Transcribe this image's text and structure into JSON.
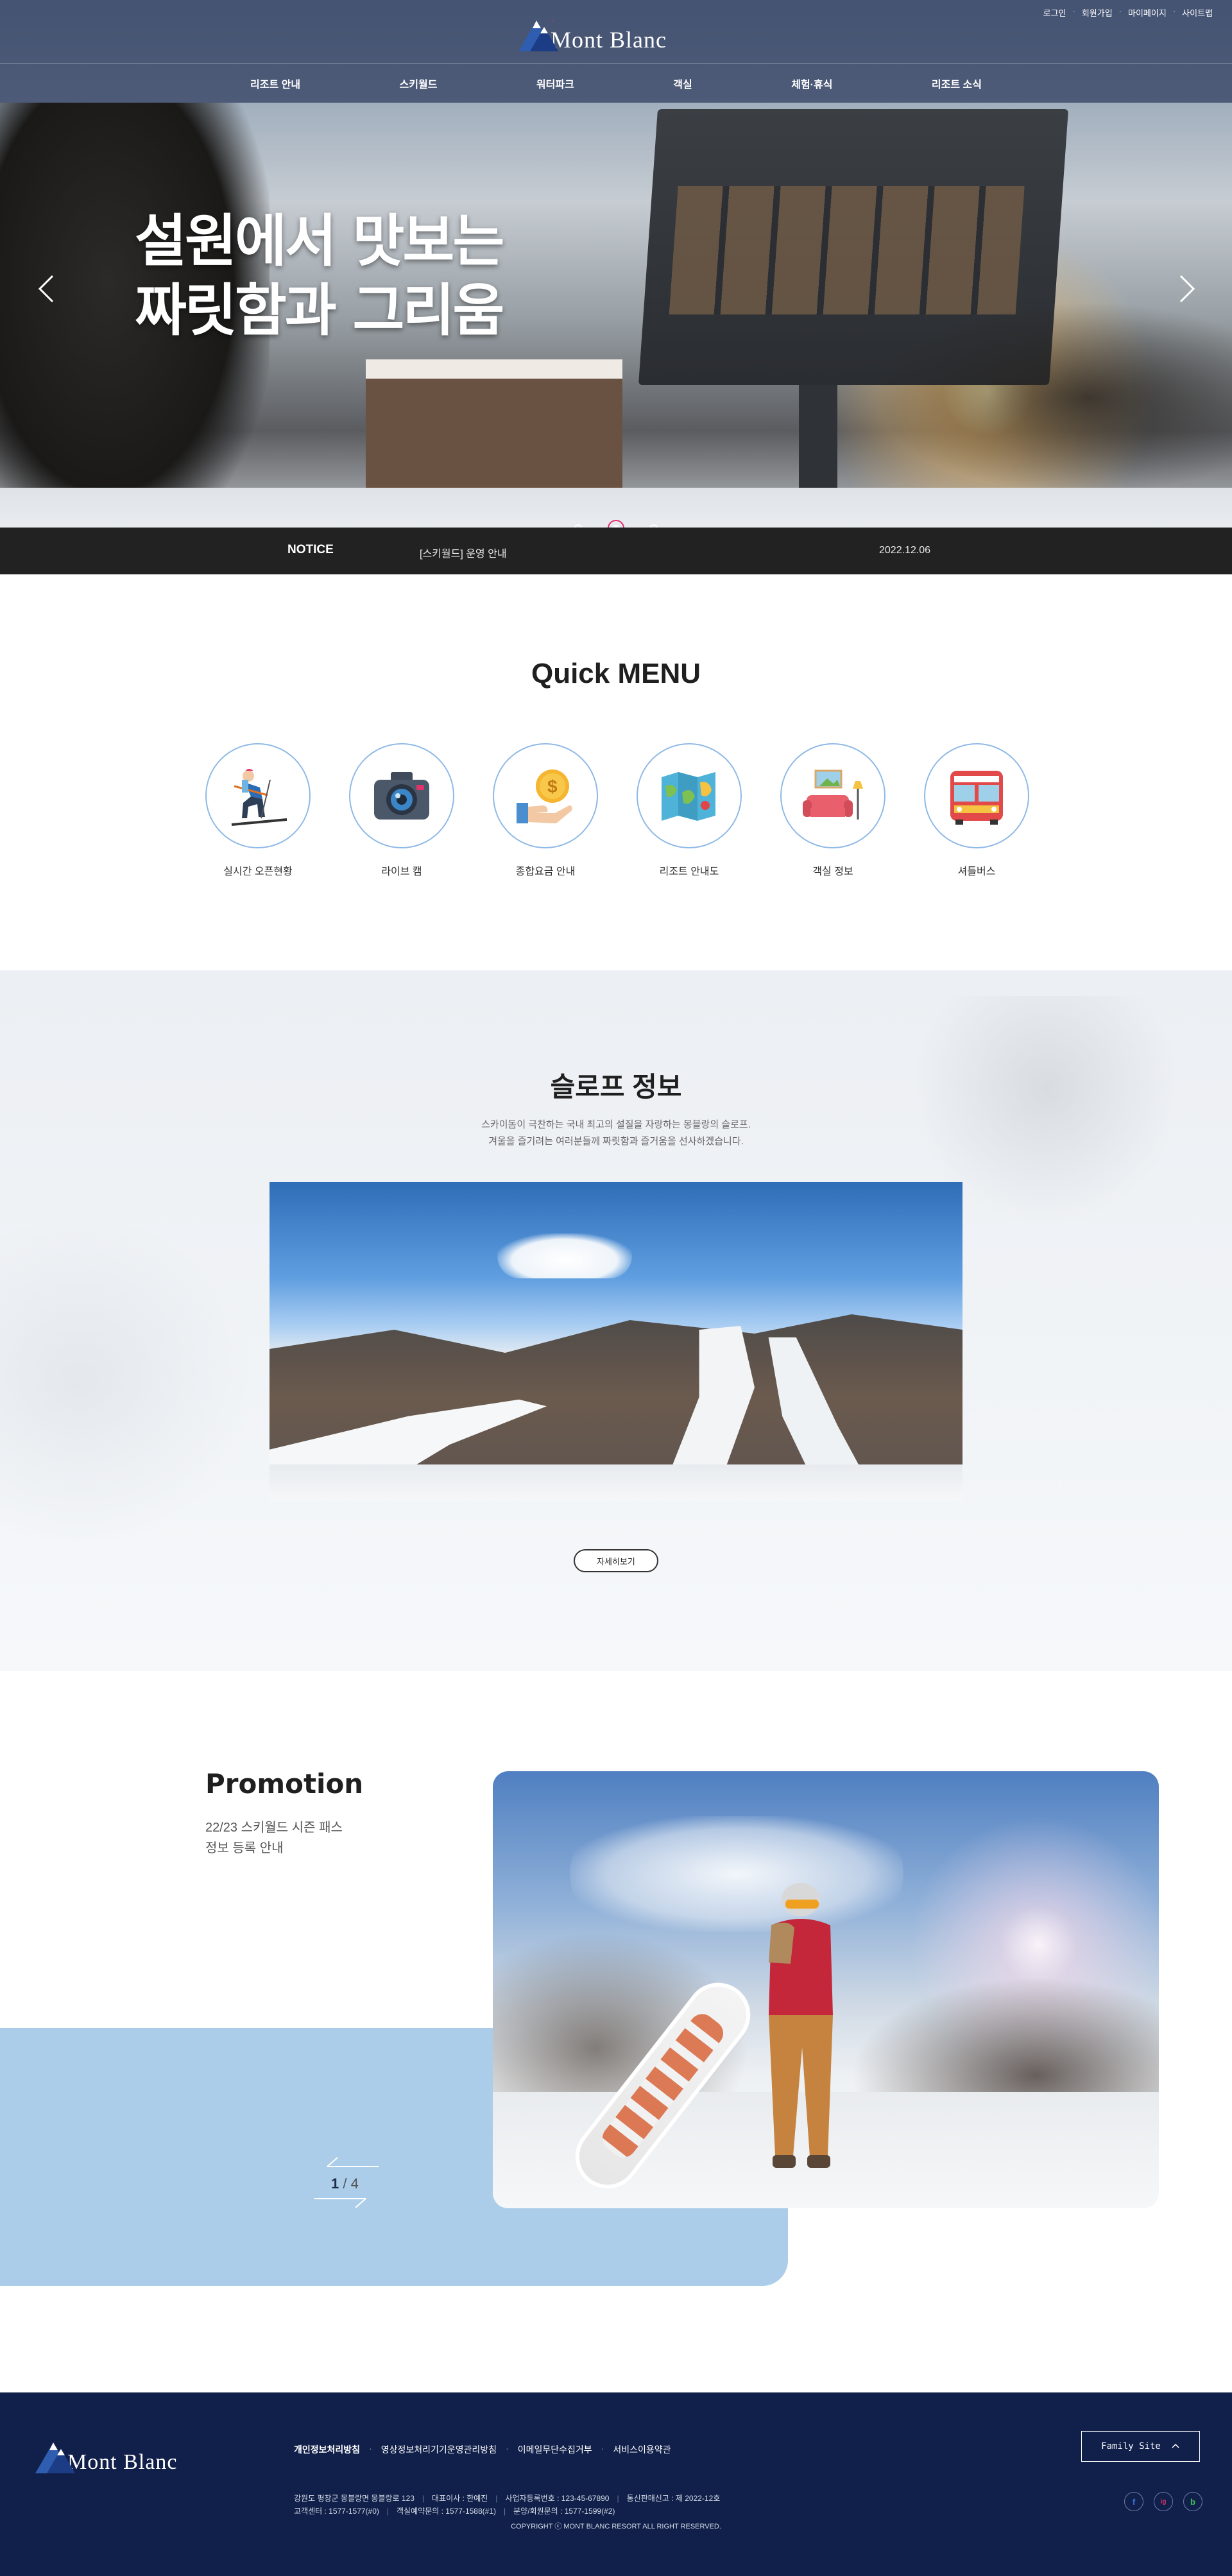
{
  "header": {
    "util_links": [
      "로그인",
      "회원가입",
      "마이페이지",
      "사이트맵"
    ],
    "logo_text": "Mont Blanc",
    "nav": [
      "리조트 안내",
      "스키월드",
      "워터파크",
      "객실",
      "체험·휴식",
      "리조트 소식"
    ]
  },
  "hero": {
    "title_line1": "설원에서 맛보는",
    "title_line2": "짜릿함과 그리움",
    "slide_count": 3,
    "active_slide": 2
  },
  "notice": {
    "label": "NOTICE",
    "text": "[스키월드] 운영 안내",
    "date": "2022.12.06"
  },
  "quick_menu": {
    "title": "Quick MENU",
    "items": [
      {
        "label": "실시간 오픈현황",
        "icon": "skier-icon"
      },
      {
        "label": "라이브 캠",
        "icon": "camera-icon"
      },
      {
        "label": "종합요금 안내",
        "icon": "coin-hand-icon"
      },
      {
        "label": "리조트 안내도",
        "icon": "map-icon"
      },
      {
        "label": "객실 정보",
        "icon": "sofa-icon"
      },
      {
        "label": "셔틀버스",
        "icon": "bus-icon"
      }
    ]
  },
  "slope": {
    "title": "슬로프 정보",
    "desc_line1": "스카이돔이 극찬하는 국내 최고의 설질을 자랑하는 몽블랑의 슬로프.",
    "desc_line2": "겨울을 즐기려는 여러분들께 짜릿함과 즐거움을 선사하겠습니다.",
    "button": "자세히보기"
  },
  "promotion": {
    "title": "Promotion",
    "desc_line1": "22/23 스키월드 시즌 패스",
    "desc_line2": "정보 등록 안내",
    "page_current": "1",
    "page_total": "/ 4"
  },
  "footer": {
    "logo_text": "Mont Blanc",
    "links": [
      "개인정보처리방침",
      "영상정보처리기기운영관리방침",
      "이메일무단수집거부",
      "서비스이용약관"
    ],
    "info_row1": [
      "강원도 평창군 몽블랑면 몽블랑로 123",
      "대표이사 : 한예진",
      "사업자등록번호 : 123-45-67890",
      "통신판매신고 : 제 2022-12호"
    ],
    "info_row2": [
      "고객센터 : 1577-1577(#0)",
      "객실예약문의 : 1577-1588(#1)",
      "분양/회원문의 : 1577-1599(#2)"
    ],
    "copyright": "COPYRIGHT ⓒ MONT BLANC RESORT ALL RIGHT RESERVED.",
    "family_site": "Family Site",
    "sns": [
      "f",
      "ig",
      "b"
    ]
  }
}
